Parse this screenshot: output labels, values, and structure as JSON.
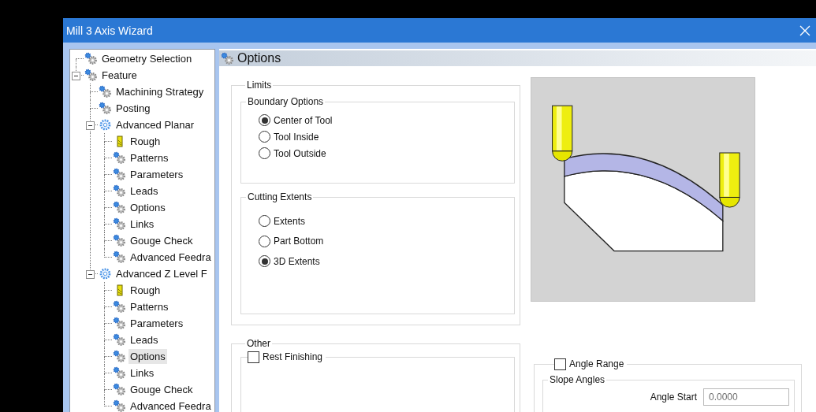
{
  "window": {
    "title": "Mill 3 Axis Wizard"
  },
  "tree": [
    {
      "label": "Geometry Selection",
      "kind": "gears",
      "selected": false
    },
    {
      "label": "Feature",
      "kind": "gears",
      "selected": false,
      "expanded": true,
      "children": [
        {
          "label": "Machining Strategy",
          "kind": "gears",
          "selected": false
        },
        {
          "label": "Posting",
          "kind": "gears",
          "selected": false
        },
        {
          "label": "Advanced Planar",
          "kind": "gear",
          "selected": false,
          "expanded": true,
          "children": [
            {
              "label": "Rough",
              "kind": "tool",
              "selected": false
            },
            {
              "label": "Patterns",
              "kind": "gears",
              "selected": false
            },
            {
              "label": "Parameters",
              "kind": "gears",
              "selected": false
            },
            {
              "label": "Leads",
              "kind": "gears",
              "selected": false
            },
            {
              "label": "Options",
              "kind": "gears",
              "selected": false
            },
            {
              "label": "Links",
              "kind": "gears",
              "selected": false
            },
            {
              "label": "Gouge Check",
              "kind": "gears",
              "selected": false
            },
            {
              "label": "Advanced Feedra",
              "kind": "gears",
              "selected": false
            }
          ]
        },
        {
          "label": "Advanced Z Level F",
          "kind": "gear",
          "selected": false,
          "expanded": true,
          "children": [
            {
              "label": "Rough",
              "kind": "tool",
              "selected": false
            },
            {
              "label": "Patterns",
              "kind": "gears",
              "selected": false
            },
            {
              "label": "Parameters",
              "kind": "gears",
              "selected": false
            },
            {
              "label": "Leads",
              "kind": "gears",
              "selected": false
            },
            {
              "label": "Options",
              "kind": "gears",
              "selected": true
            },
            {
              "label": "Links",
              "kind": "gears",
              "selected": false
            },
            {
              "label": "Gouge Check",
              "kind": "gears",
              "selected": false
            },
            {
              "label": "Advanced Feedra",
              "kind": "gears",
              "selected": false
            }
          ]
        }
      ]
    }
  ],
  "panel": {
    "title": "Options"
  },
  "limits": {
    "label": "Limits",
    "groups": [
      {
        "label": "Boundary Options",
        "options": [
          {
            "label": "Center of Tool",
            "selected": true
          },
          {
            "label": "Tool Inside",
            "selected": false
          },
          {
            "label": "Tool Outside",
            "selected": false
          }
        ]
      },
      {
        "label": "Cutting Extents",
        "options": [
          {
            "label": "Extents",
            "selected": false
          },
          {
            "label": "Part Bottom",
            "selected": false
          },
          {
            "label": "3D Extents",
            "selected": true
          }
        ]
      }
    ]
  },
  "other": {
    "label": "Other",
    "rest_finishing": {
      "label": "Rest Finishing",
      "checked": false
    }
  },
  "angle_range": {
    "label": "Angle Range",
    "checked": false,
    "slope_angles": {
      "label": "Slope Angles",
      "fields": [
        {
          "label": "Angle Start",
          "value": "0.0000"
        }
      ]
    }
  }
}
